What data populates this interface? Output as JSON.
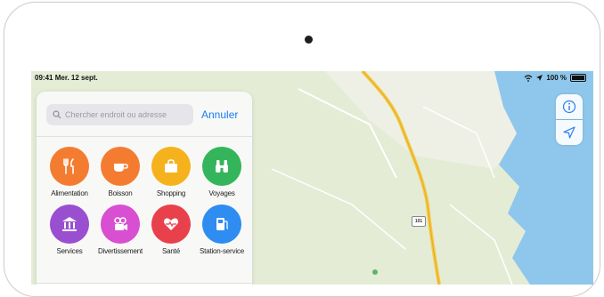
{
  "status_bar": {
    "time": "09:41",
    "date": "Mer. 12 sept.",
    "battery": "100 %"
  },
  "search": {
    "placeholder": "Chercher endroit ou adresse",
    "cancel_label": "Annuler"
  },
  "categories": [
    {
      "label": "Alimentation",
      "color": "#f47c31",
      "icon": "fork-knife-icon"
    },
    {
      "label": "Boisson",
      "color": "#f47c31",
      "icon": "cup-icon"
    },
    {
      "label": "Shopping",
      "color": "#f6b21c",
      "icon": "bag-icon"
    },
    {
      "label": "Voyages",
      "color": "#35b55b",
      "icon": "binoculars-icon"
    },
    {
      "label": "Services",
      "color": "#9a4fd1",
      "icon": "bank-icon"
    },
    {
      "label": "Divertissement",
      "color": "#d94fd1",
      "icon": "film-icon"
    },
    {
      "label": "Santé",
      "color": "#e8414b",
      "icon": "heart-icon"
    },
    {
      "label": "Station-service",
      "color": "#2f8cf0",
      "icon": "fuel-icon"
    }
  ],
  "map": {
    "road_shield": "101",
    "water_color": "#8fc7ec",
    "land_color": "#e4ecd6",
    "road_color": "#f5c944"
  },
  "controls": {
    "info_icon": "info-icon",
    "location_icon": "location-arrow-icon"
  }
}
